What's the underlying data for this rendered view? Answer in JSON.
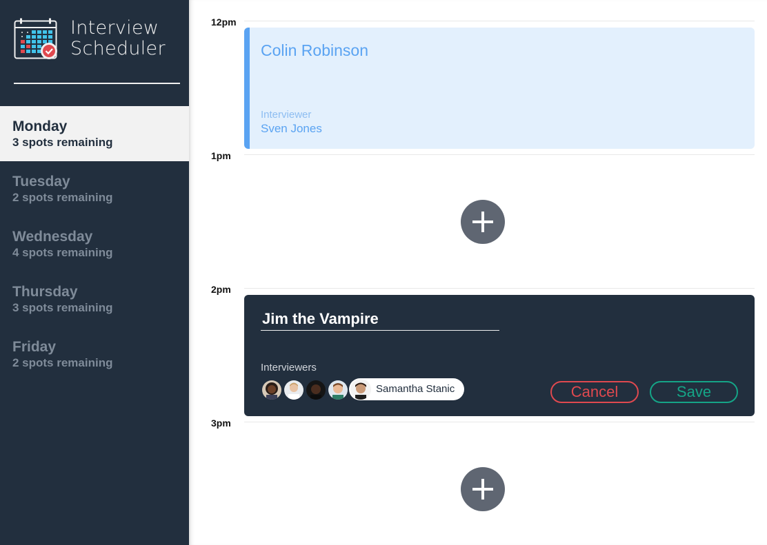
{
  "app": {
    "title_line1": "Interview",
    "title_line2": "Scheduler"
  },
  "colors": {
    "sidebar_bg": "#222f3e",
    "accent_blue": "#5aa3f2",
    "appointment_bg": "#e3f0fd",
    "cancel_red": "#e0494f",
    "save_green": "#15a587",
    "add_button": "#5f6672"
  },
  "days": [
    {
      "name": "Monday",
      "spots": "3 spots remaining",
      "selected": true
    },
    {
      "name": "Tuesday",
      "spots": "2 spots remaining",
      "selected": false
    },
    {
      "name": "Wednesday",
      "spots": "4 spots remaining",
      "selected": false
    },
    {
      "name": "Thursday",
      "spots": "3 spots remaining",
      "selected": false
    },
    {
      "name": "Friday",
      "spots": "2 spots remaining",
      "selected": false
    }
  ],
  "schedule": {
    "times": [
      "12pm",
      "1pm",
      "2pm",
      "3pm"
    ],
    "appointment": {
      "student": "Colin Robinson",
      "interviewer_label": "Interviewer",
      "interviewer": "Sven Jones"
    },
    "form": {
      "student_value": "Jim the Vampire",
      "interviewers_label": "Interviewers",
      "selected_interviewer": "Samantha Stanic",
      "cancel_label": "Cancel",
      "save_label": "Save"
    },
    "icons": {
      "add": "plus-icon",
      "logo": "calendar-check-icon"
    }
  }
}
